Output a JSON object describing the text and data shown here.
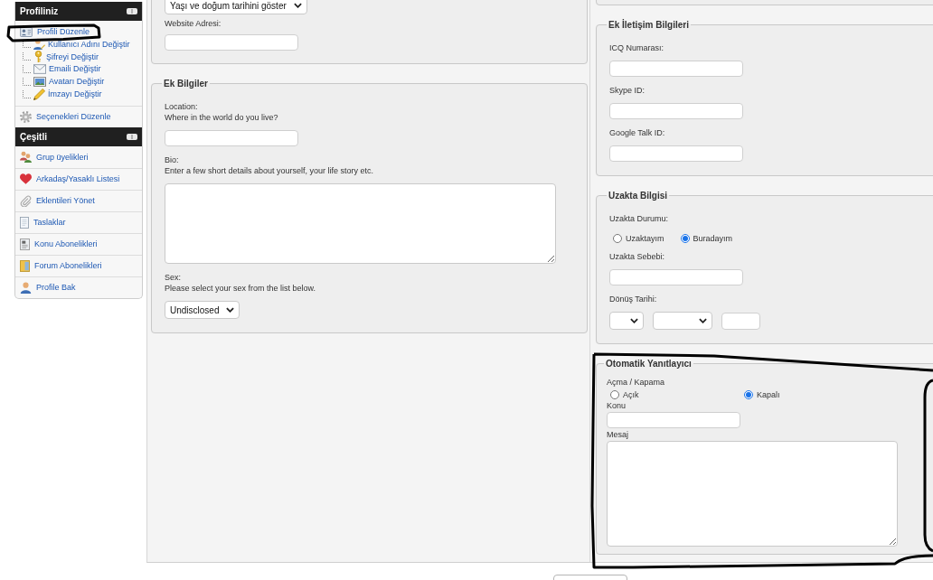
{
  "sidebar": {
    "sections": [
      {
        "title": "Profiliniz",
        "items": [
          {
            "label": "Profili Düzenle",
            "children": [
              {
                "label": "Kullanıcı Adını Değiştir"
              },
              {
                "label": "Şifreyi Değiştir"
              },
              {
                "label": "Emaili Değiştir"
              },
              {
                "label": "Avatarı Değiştir"
              },
              {
                "label": "İmzayı Değiştir"
              }
            ]
          },
          {
            "label": "Seçenekleri Düzenle"
          }
        ]
      },
      {
        "title": "Çeşitli",
        "items": [
          {
            "label": "Grup üyelikleri"
          },
          {
            "label": "Arkadaş/Yasaklı Listesi"
          },
          {
            "label": "Eklentileri Yönet"
          },
          {
            "label": "Taslaklar"
          },
          {
            "label": "Konu Abonelikleri"
          },
          {
            "label": "Forum Abonelikleri"
          },
          {
            "label": "Profile Bak"
          }
        ]
      }
    ]
  },
  "main_column": {
    "fieldsets": [
      {
        "kind": "clipped",
        "fields": [
          {
            "kind": "select",
            "value": "Yaşı ve doğum tarihini göster"
          },
          {
            "kind": "text",
            "label": "Website Adresi:"
          }
        ]
      },
      {
        "kind": "standard",
        "legend": "Ek Bilgiler",
        "fields": [
          {
            "kind": "text",
            "label": "Location:",
            "description": "Where in the world do you live?"
          },
          {
            "kind": "textarea",
            "label": "Bio:",
            "description": "Enter a few short details about yourself, your life story etc."
          },
          {
            "kind": "select",
            "label": "Sex:",
            "description": "Please select your sex from the list below.",
            "value": "Undisclosed"
          }
        ]
      }
    ]
  },
  "side_column": {
    "fieldsets": [
      {
        "kind": "clipped"
      },
      {
        "kind": "standard",
        "legend": "Ek İletişim Bilgileri",
        "fields": [
          {
            "kind": "text",
            "label": "ICQ Numarası:"
          },
          {
            "kind": "text",
            "label": "Skype ID:"
          },
          {
            "kind": "text",
            "label": "Google Talk ID:"
          }
        ]
      },
      {
        "kind": "standard",
        "legend": "Uzakta Bilgisi",
        "fields": [
          {
            "kind": "radios",
            "label": "Uzakta Durumu:",
            "options": [
              {
                "label": "Uzaktayım",
                "selected": false
              },
              {
                "label": "Buradayım",
                "selected": true
              }
            ]
          },
          {
            "kind": "text",
            "label": "Uzakta Sebebi:"
          },
          {
            "kind": "date",
            "label": "Dönüş Tarihi:"
          }
        ]
      },
      {
        "kind": "compact",
        "legend": "Otomatik Yanıtlayıcı",
        "fields": [
          {
            "kind": "radios",
            "label": "Açma / Kapama",
            "options": [
              {
                "label": "Açık",
                "selected": false
              },
              {
                "label": "Kapalı",
                "selected": true
              }
            ]
          },
          {
            "kind": "text",
            "label": "Konu"
          },
          {
            "kind": "textarea",
            "label": "Mesaj"
          }
        ]
      }
    ]
  }
}
